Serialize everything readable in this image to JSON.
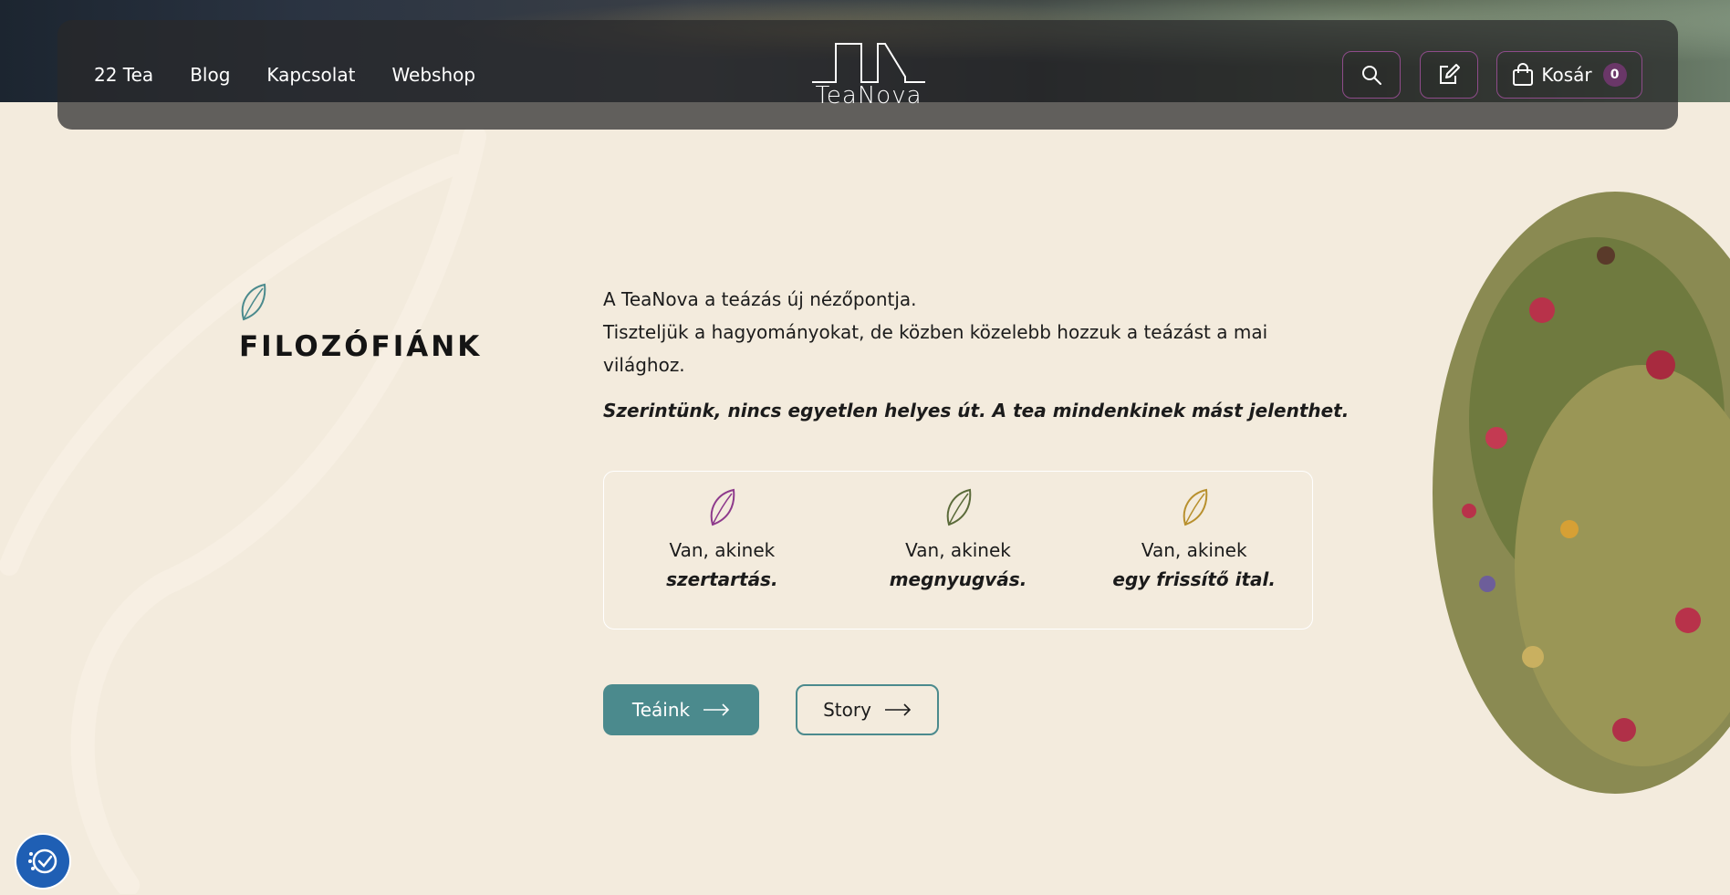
{
  "header": {
    "nav": [
      "22 Tea",
      "Blog",
      "Kapcsolat",
      "Webshop"
    ],
    "logo_text": "TeaNova",
    "cart_label": "Kosár",
    "cart_count": "0",
    "search_icon": "search-icon",
    "edit_icon": "edit-icon",
    "bag_icon": "shopping-bag-icon"
  },
  "section": {
    "title": "FILOZÓFIÁNK",
    "intro_line1": "A TeaNova a teázás új nézőpontja.",
    "intro_line2": "Tiszteljük a hagyományokat, de közben közelebb hozzuk a teázást a mai világhoz.",
    "motto": "Szerintünk, nincs egyetlen helyes út. A tea mindenkinek mást jelenthet."
  },
  "cards": [
    {
      "line1": "Van, akinek",
      "line2": "szertartás.",
      "color": "#8e3a8c"
    },
    {
      "line1": "Van, akinek",
      "line2": "megnyugvás.",
      "color": "#5b6b3a"
    },
    {
      "line1": "Van, akinek",
      "line2": "egy frissítő ital.",
      "color": "#b8902e"
    }
  ],
  "buttons": {
    "primary": "Teáink",
    "secondary": "Story"
  },
  "colors": {
    "accent_teal": "#4b8a8d",
    "header_border_purple": "#8e4c8a",
    "background": "#f3ebdd",
    "accessibility_blue": "#1f5fb4"
  }
}
